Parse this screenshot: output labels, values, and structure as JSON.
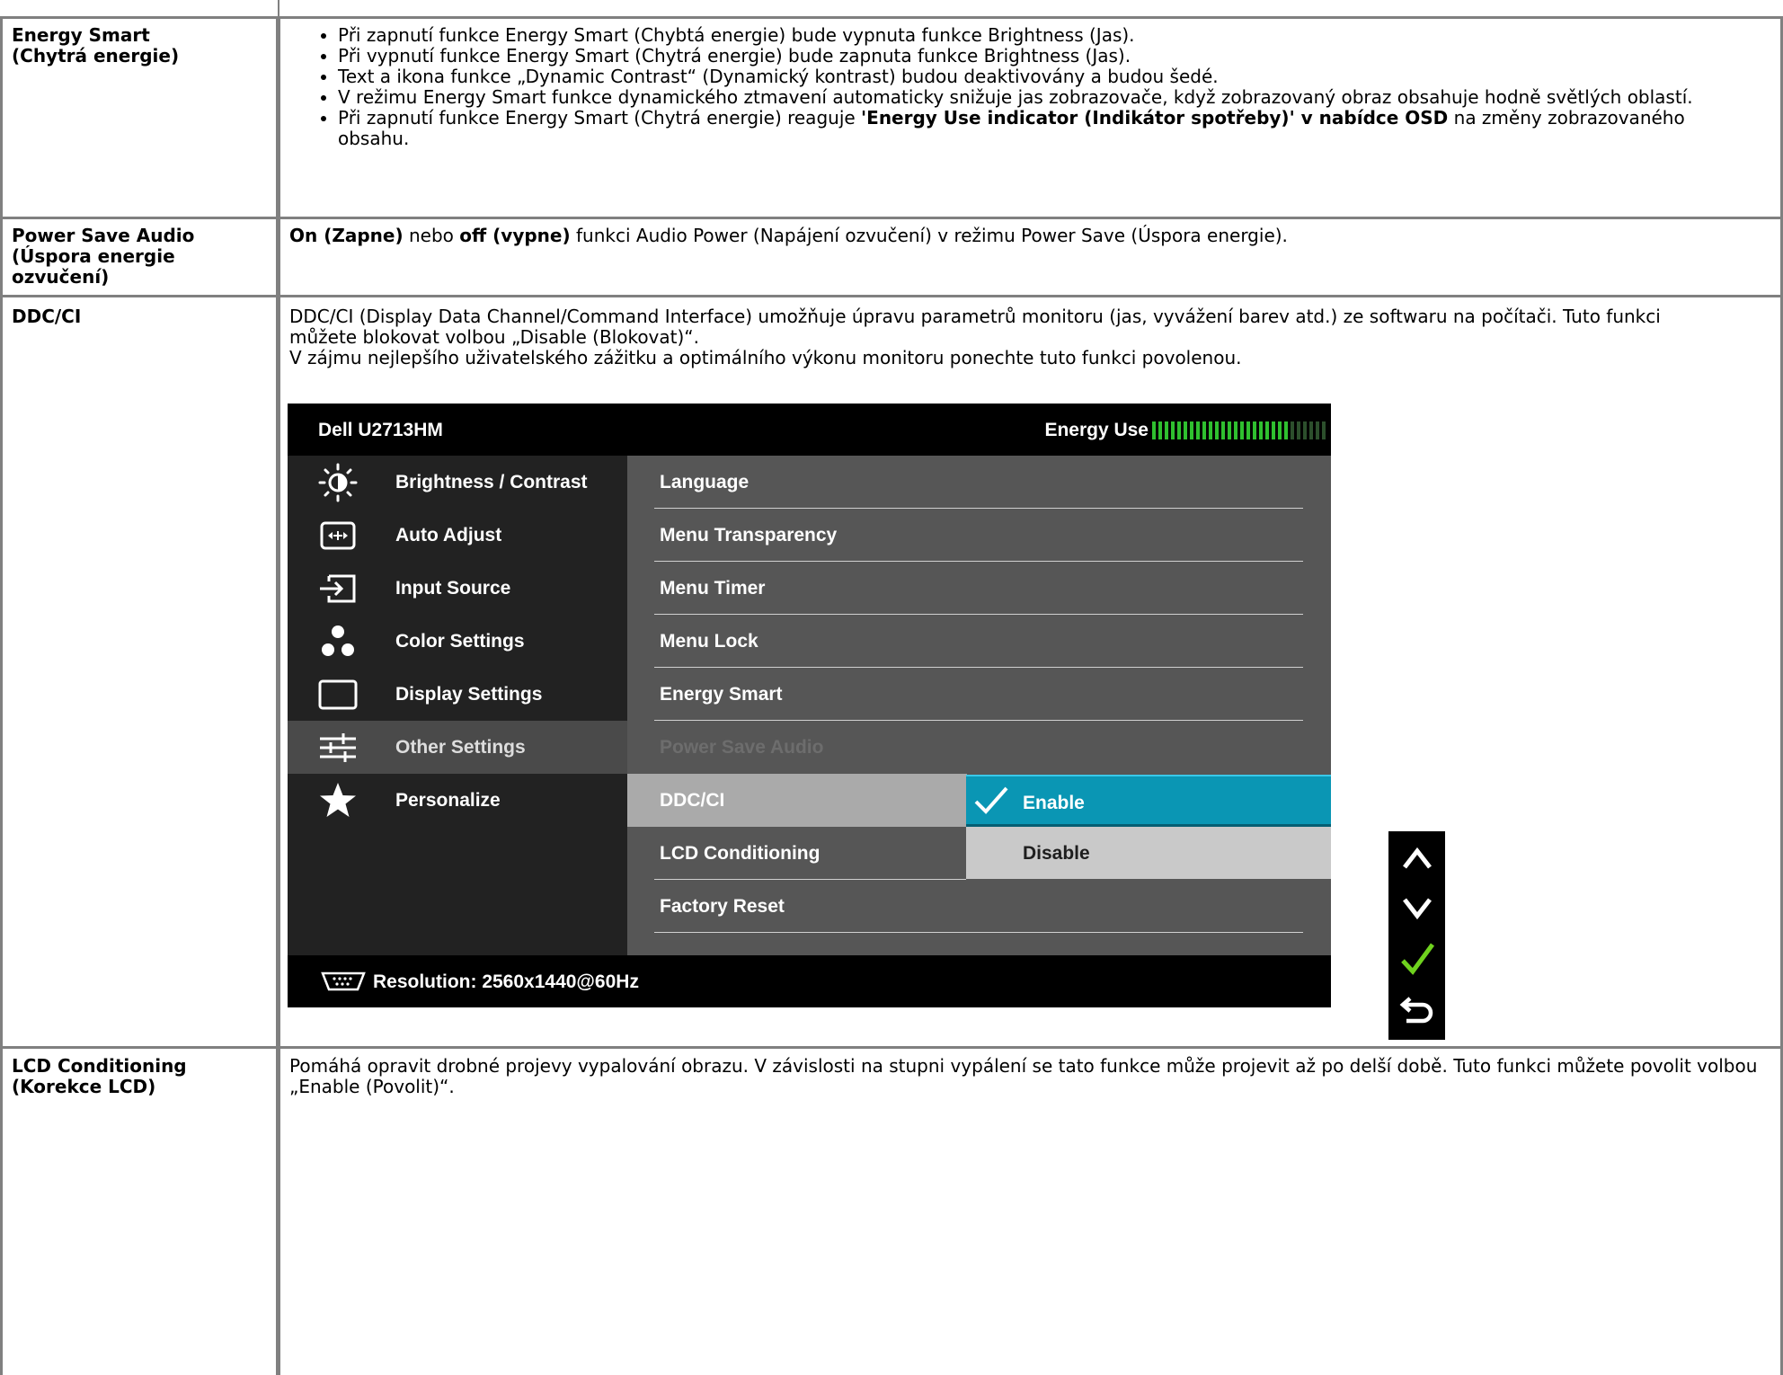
{
  "rows": [
    {
      "label_line1": "Energy Smart",
      "label_line2": "(Chytrá energie)",
      "bullets": [
        "Při zapnutí funkce Energy Smart (Chybtá energie) bude vypnuta funkce Brightness (Jas).",
        "Při vypnutí funkce Energy Smart (Chytrá energie) bude zapnuta funkce Brightness (Jas).",
        "Text a ikona funkce „Dynamic Contrast“ (Dynamický kontrast) budou deaktivovány a budou šedé.",
        "V režimu Energy Smart funkce dynamického ztmavení automaticky snižuje jas zobrazovače, když zobrazovaný obraz obsahuje hodně světlých oblastí."
      ],
      "bullet5_pre": "Při zapnutí funkce Energy Smart (Chytrá energie) reaguje ",
      "bullet5_bold": "'Energy Use indicator (Indikátor spotřeby)' v nabídce OSD",
      "bullet5_post": " na změny zobrazovaného obsahu."
    },
    {
      "label_line1": "Power Save Audio",
      "label_line2": "(Úspora energie",
      "label_line3": "ozvučení)",
      "on_bold": "On (Zapne)",
      "mid": " nebo ",
      "off_bold": "off (vypne)",
      "rest": " funkci Audio Power (Napájení ozvučení) v režimu Power Save (Úspora energie)."
    },
    {
      "label_line1": "DDC/CI",
      "para1": "DDC/CI (Display Data Channel/Command Interface) umožňuje úpravu parametrů monitoru (jas, vyvážení barev atd.) ze softwaru na počítači. Tuto funkci můžete blokovat volbou „Disable (Blokovat)“.",
      "para2": "V zájmu nejlepšího uživatelského zážitku a optimálního výkonu monitoru ponechte tuto funkci povolenou."
    },
    {
      "label_line1": "LCD Conditioning",
      "label_line2": "(Korekce LCD)",
      "para1": "Pomáhá opravit drobné projevy vypalování obrazu. V závislosti na stupni vypálení se tato funkce může projevit až po delší době. Tuto funkci můžete povolit volbou „Enable (Povolit)“."
    }
  ],
  "osd": {
    "model": "Dell U2713HM",
    "energy_label": "Energy Use",
    "energy_level": 0.78,
    "energy_color_on": "#2fc02f",
    "energy_color_off": "#2c4f2c",
    "menu": [
      {
        "label": "Brightness / Contrast",
        "icon": "brightness-icon"
      },
      {
        "label": "Auto Adjust",
        "icon": "auto-adjust-icon"
      },
      {
        "label": "Input Source",
        "icon": "input-source-icon"
      },
      {
        "label": "Color Settings",
        "icon": "color-settings-icon"
      },
      {
        "label": "Display Settings",
        "icon": "display-settings-icon"
      },
      {
        "label": "Other Settings",
        "icon": "other-settings-icon"
      },
      {
        "label": "Personalize",
        "icon": "star-icon"
      }
    ],
    "submenu": [
      "Language",
      "Menu Transparency",
      "Menu Timer",
      "Menu Lock",
      "Energy Smart",
      "Power Save Audio",
      "DDC/CI",
      "LCD Conditioning",
      "Factory Reset"
    ],
    "options": [
      "Enable",
      "Disable"
    ],
    "selected_option": "Enable",
    "resolution": "Resolution: 2560x1440@60Hz",
    "accent": "#0a96b4"
  },
  "nav_buttons": [
    "up-arrow-icon",
    "down-arrow-icon",
    "check-icon",
    "back-icon"
  ]
}
